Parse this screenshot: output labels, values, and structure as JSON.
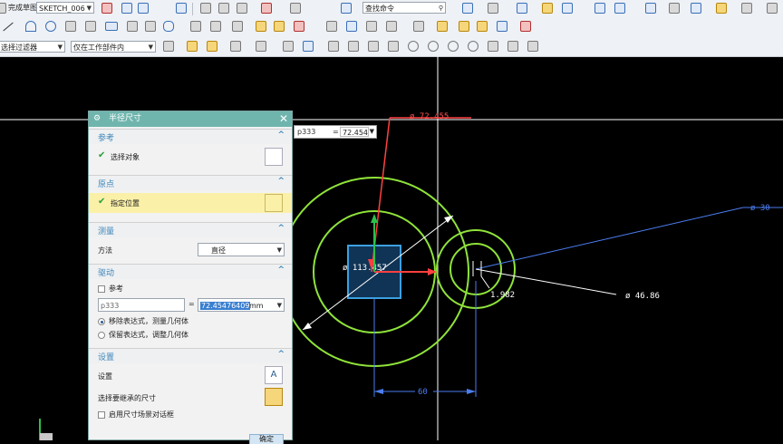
{
  "toolbar_top": {
    "finish_sketch_label": "完成草图",
    "sketch_name": "SKETCH_006",
    "command_search_placeholder": "查找命令"
  },
  "selection_bar": {
    "filter_label": "选择过滤器",
    "scope_label": "仅在工作部件内"
  },
  "dialog": {
    "title": "半径尺寸",
    "sections": {
      "reference": {
        "header": "参考",
        "select_object_label": "选择对象"
      },
      "origin": {
        "header": "原点",
        "specify_location_label": "指定位置"
      },
      "measurement": {
        "header": "测量",
        "method_label": "方法",
        "method_value": "直径"
      },
      "driving": {
        "header": "驱动",
        "reference_checkbox_label": "参考",
        "expression_name": "p333",
        "equals": "=",
        "value": "72.45476409",
        "unit": "mm",
        "option_move_expr": "移除表达式，测量几何体",
        "option_keep_expr": "保留表达式，调整几何体"
      },
      "settings": {
        "header": "设置",
        "settings_label": "设置",
        "select_chain_label": "选择要继承的尺寸",
        "enable_dialog_label": "启用尺寸场景对话框"
      }
    },
    "ok_label": "确定"
  },
  "floating_input": {
    "name": "p333",
    "equals": "=",
    "value": "72.454"
  },
  "dimensions": {
    "diameter_large": "ø 72.455",
    "diameter_selected": "ø 113.457",
    "diameter_small": "ø 46.86",
    "diameter_30": "ø 30",
    "radial_1982": "1.982",
    "horizontal_60": "60"
  },
  "colors": {
    "background": "#000000",
    "circle": "#8fe33a",
    "dimension_white": "#ffffff",
    "dimension_blue": "#4c7df0",
    "active_red": "#ff4040",
    "panel_header": "#6fb5ae",
    "selection_box": "#3da0e0"
  }
}
